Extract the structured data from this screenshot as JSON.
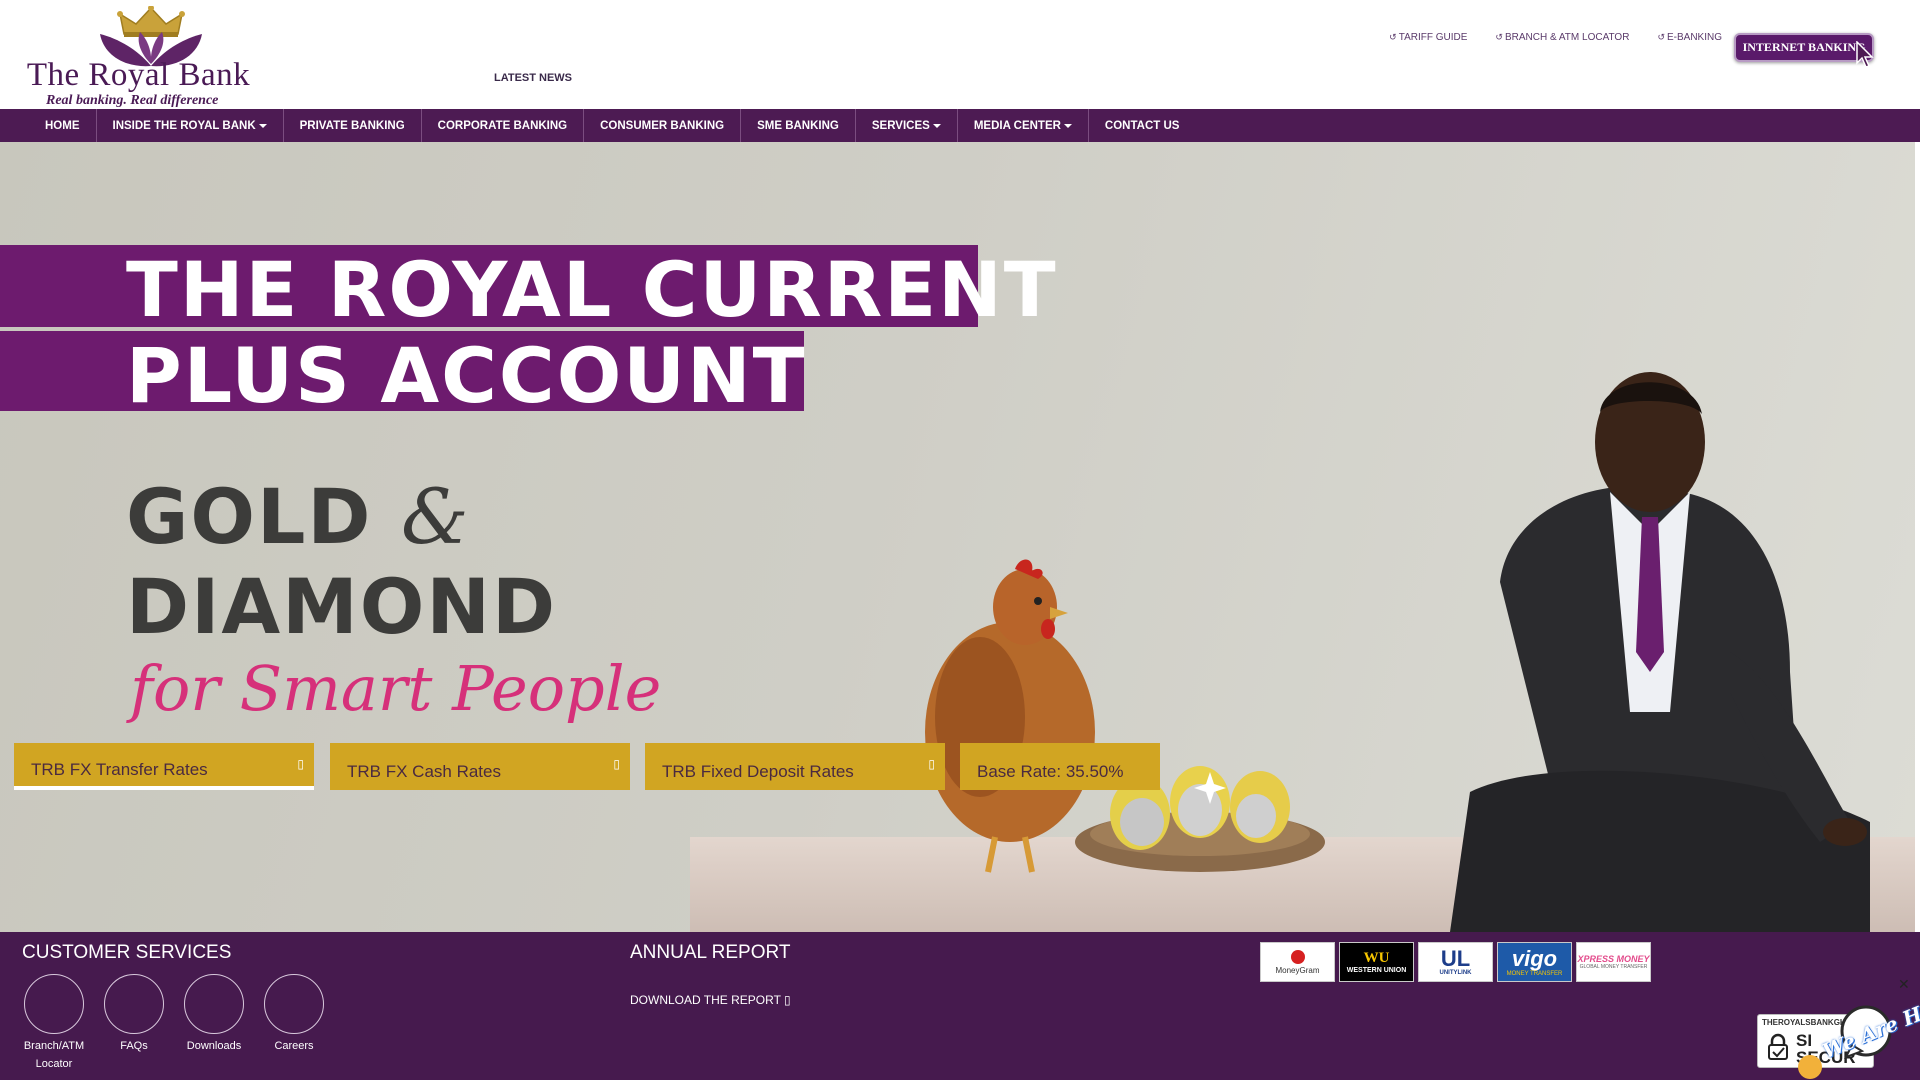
{
  "brand": {
    "name": "The Royal Bank",
    "tagline": "Real banking. Real difference",
    "colors": {
      "primary": "#4d1b53",
      "accent": "#6d1b6e",
      "gold": "#d1a522",
      "pink": "#d6307a"
    }
  },
  "header": {
    "latest_news": "LATEST NEWS",
    "top_links": [
      {
        "label": "TARIFF GUIDE",
        "icon": "link-arrow-icon"
      },
      {
        "label": "BRANCH & ATM LOCATOR",
        "icon": "link-arrow-icon"
      },
      {
        "label": "E-BANKING",
        "icon": "link-arrow-icon"
      }
    ],
    "internet_banking": "INTERNET BANKING"
  },
  "nav": {
    "items": [
      {
        "label": "HOME",
        "dropdown": false
      },
      {
        "label": "INSIDE THE ROYAL BANK",
        "dropdown": true
      },
      {
        "label": "PRIVATE BANKING",
        "dropdown": false
      },
      {
        "label": "CORPORATE BANKING",
        "dropdown": false
      },
      {
        "label": "CONSUMER BANKING",
        "dropdown": false
      },
      {
        "label": "SME BANKING",
        "dropdown": false
      },
      {
        "label": "SERVICES",
        "dropdown": true
      },
      {
        "label": "MEDIA CENTER",
        "dropdown": true
      },
      {
        "label": "CONTACT US",
        "dropdown": false
      }
    ]
  },
  "hero": {
    "line1": "THE ROYAL CURRENT",
    "line2": "PLUS ACCOUNT",
    "gold": "GOLD",
    "amp": "&",
    "diamond": "DIAMOND",
    "tagline": "for Smart People"
  },
  "rate_tabs": [
    {
      "label": "TRB FX Transfer Rates",
      "icon": "expand-icon",
      "active": true
    },
    {
      "label": "TRB FX Cash Rates",
      "icon": "expand-icon",
      "active": false
    },
    {
      "label": "TRB Fixed Deposit Rates",
      "icon": "expand-icon",
      "active": false
    },
    {
      "label": "Base Rate: 35.50%",
      "active": false
    }
  ],
  "customer_services": {
    "title": "CUSTOMER SERVICES",
    "items": [
      {
        "label": "Branch/ATM Locator"
      },
      {
        "label": "FAQs"
      },
      {
        "label": "Downloads"
      },
      {
        "label": "Careers"
      }
    ]
  },
  "annual_report": {
    "title": "ANNUAL REPORT",
    "link": "DOWNLOAD THE REPORT ▯"
  },
  "partners": [
    {
      "name": "MoneyGram"
    },
    {
      "name": "WU",
      "sub": "WESTERN UNION"
    },
    {
      "name": "UL",
      "sub": "UNITYLINK"
    },
    {
      "name": "vigo",
      "sub": "MONEY TRANSFER"
    },
    {
      "name": "XPRESS MONEY",
      "sub": "GLOBAL MONEY TRANSFER"
    }
  ],
  "secure_badge": {
    "domain": "THEROYALSBANKGH",
    "text": "SI SECUR"
  },
  "chat": {
    "label": "We Are Here!",
    "close": "✕"
  }
}
